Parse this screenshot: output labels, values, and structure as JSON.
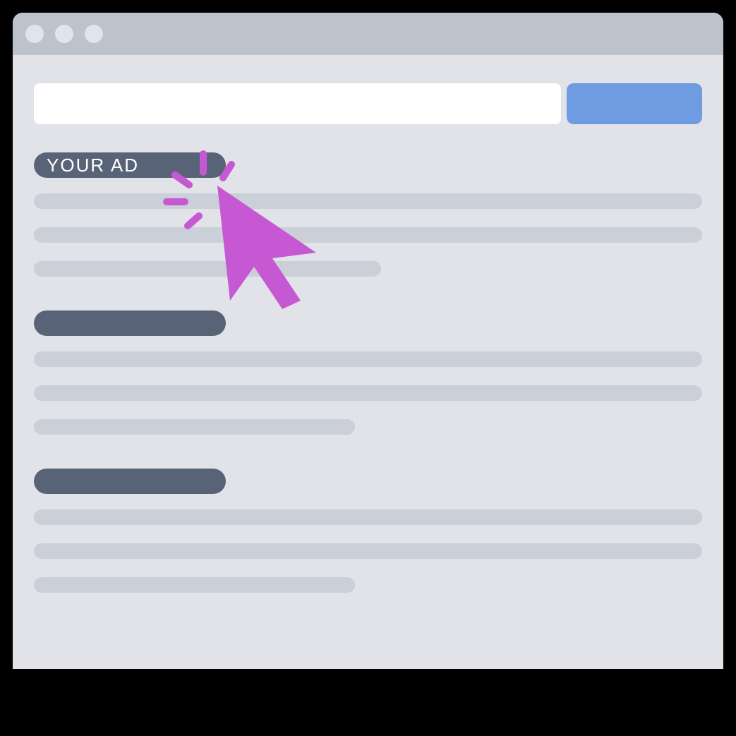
{
  "ad": {
    "label": "YOUR AD"
  },
  "colors": {
    "browser_bg": "#e1e3e9",
    "title_bar": "#bdc3cb",
    "search_button": "#6f9ce1",
    "result_title": "#596377",
    "result_line": "#cbcfd7",
    "cursor_fill": "#c758d3",
    "cursor_sparks": "#c758d3"
  }
}
